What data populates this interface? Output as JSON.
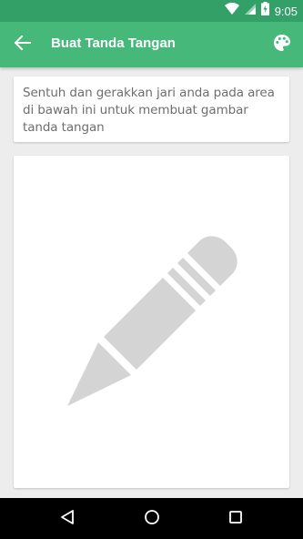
{
  "status_bar": {
    "time": "9:05",
    "icons": [
      "wifi-icon",
      "signal-icon",
      "battery-charging-icon"
    ]
  },
  "app_bar": {
    "title": "Buat Tanda Tangan",
    "back_icon": "arrow-back-icon",
    "action_icon": "palette-icon"
  },
  "instruction": {
    "text": "Sentuh dan gerakkan jari anda pada area di bawah ini untuk membuat gambar tanda tangan"
  },
  "signature_canvas": {
    "placeholder_icon": "pencil-icon"
  },
  "nav_bar": {
    "buttons": [
      "back-triangle-icon",
      "home-circle-icon",
      "recents-square-icon"
    ]
  },
  "colors": {
    "primary": "#46b87a",
    "primary_dark": "#33a167",
    "background": "#ededed",
    "text_secondary": "#6e6e6e",
    "placeholder_icon": "#d4d4d4"
  }
}
